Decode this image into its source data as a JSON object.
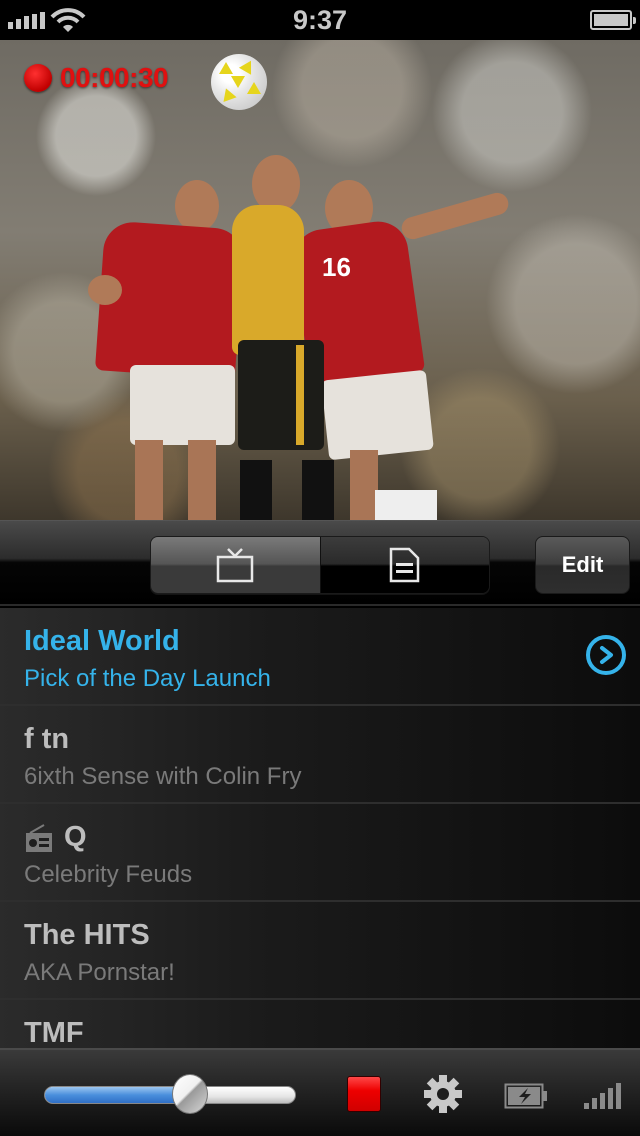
{
  "status_bar": {
    "time": "9:37",
    "signal_bars": 5,
    "wifi": "wifi-icon",
    "battery_level": 1.0
  },
  "video": {
    "recording": true,
    "record_time": "00:00:30",
    "jersey_number": "16"
  },
  "toolbar": {
    "tabs": [
      {
        "icon": "tv-icon",
        "active": true
      },
      {
        "icon": "document-icon",
        "active": false
      }
    ],
    "edit_label": "Edit"
  },
  "channels": [
    {
      "name": "Ideal World",
      "program": "Pick of the Day Launch",
      "selected": true,
      "radio": false
    },
    {
      "name": "f tn",
      "program": "6ixth Sense with Colin Fry",
      "selected": false,
      "radio": false
    },
    {
      "name": "Q",
      "program": "Celebrity Feuds",
      "selected": false,
      "radio": true
    },
    {
      "name": "The HITS",
      "program": "AKA Pornstar!",
      "selected": false,
      "radio": false
    },
    {
      "name": "TMF",
      "program": "",
      "selected": false,
      "radio": false
    }
  ],
  "bottom_bar": {
    "volume": 0.58,
    "stop_icon": "stop-icon",
    "settings_icon": "gear-icon",
    "battery_icon": "battery-charging-icon",
    "signal_icon": "signal-icon"
  },
  "colors": {
    "accent": "#35b3ea",
    "record": "#e01010",
    "stop": "#ee0000"
  }
}
